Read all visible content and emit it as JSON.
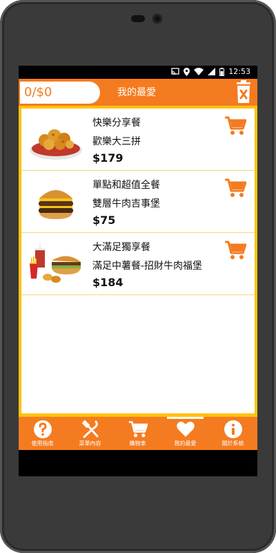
{
  "status_bar": {
    "time": "12:53",
    "icons": [
      "cast-icon",
      "location-icon",
      "wifi-icon",
      "signal-icon",
      "battery-icon"
    ]
  },
  "app_bar": {
    "counter": "0/$0",
    "title": "我的最愛",
    "trash_icon": "trash-clear-icon"
  },
  "favorites": [
    {
      "category": "快樂分享餐",
      "name": "歡樂大三拼",
      "price": "$179",
      "image": "fried-chicken-platter"
    },
    {
      "category": "單點和超值全餐",
      "name": "雙層牛肉吉事堡",
      "price": "$75",
      "image": "double-cheeseburger"
    },
    {
      "category": "大滿足獨享餐",
      "name": "滿足中薯餐-招財牛肉福堡",
      "price": "$184",
      "image": "burger-combo-meal"
    }
  ],
  "bottom_nav": [
    {
      "label": "使用指南",
      "icon": "help-icon",
      "active": false
    },
    {
      "label": "菜單內容",
      "icon": "fork-knife-icon",
      "active": false
    },
    {
      "label": "購物車",
      "icon": "cart-icon",
      "active": false
    },
    {
      "label": "我的最愛",
      "icon": "heart-icon",
      "active": true
    },
    {
      "label": "關於系統",
      "icon": "info-icon",
      "active": false
    }
  ],
  "colors": {
    "primary": "#f47b20",
    "list_border": "#ffc20e",
    "text": "#111111"
  }
}
